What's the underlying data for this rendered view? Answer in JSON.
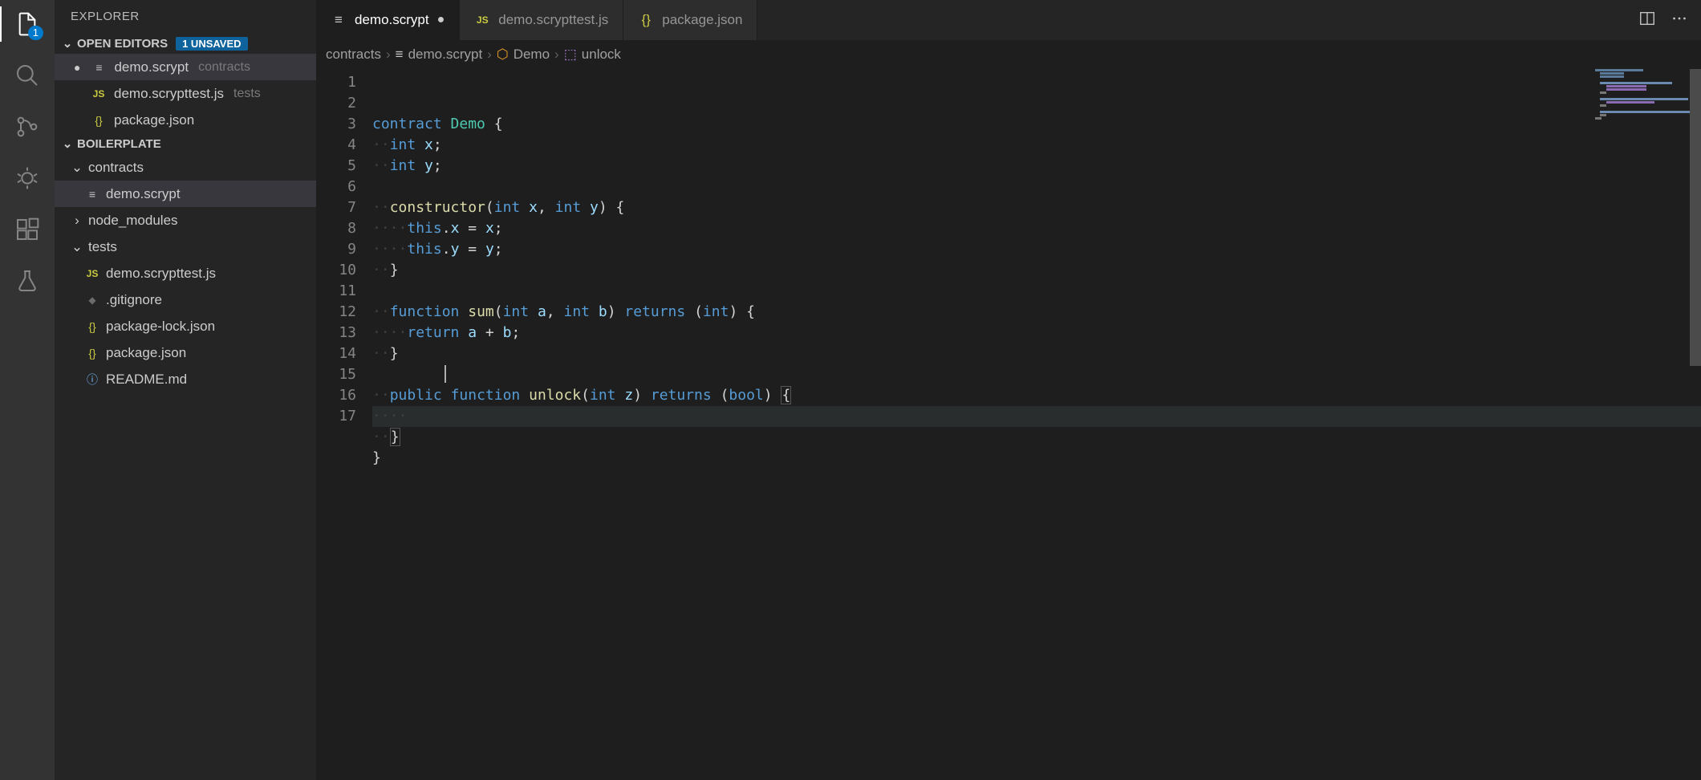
{
  "activity": {
    "explorer_badge": "1"
  },
  "sidebar": {
    "title": "EXPLORER",
    "open_editors_label": "OPEN EDITORS",
    "unsaved_label": "1 UNSAVED",
    "open_editors": [
      {
        "name": "demo.scrypt",
        "hint": "contracts",
        "dirty": true,
        "icon": "lines"
      },
      {
        "name": "demo.scrypttest.js",
        "hint": "tests",
        "dirty": false,
        "icon": "js"
      },
      {
        "name": "package.json",
        "hint": "",
        "dirty": false,
        "icon": "json"
      }
    ],
    "project_label": "BOILERPLATE",
    "tree": {
      "contracts": {
        "label": "contracts",
        "children": [
          {
            "name": "demo.scrypt",
            "icon": "lines"
          }
        ]
      },
      "node_modules": {
        "label": "node_modules"
      },
      "tests": {
        "label": "tests",
        "children": [
          {
            "name": "demo.scrypttest.js",
            "icon": "js"
          }
        ]
      },
      "gitignore": {
        "name": ".gitignore",
        "icon": "diamond"
      },
      "package_lock": {
        "name": "package-lock.json",
        "icon": "json"
      },
      "package": {
        "name": "package.json",
        "icon": "json"
      },
      "readme": {
        "name": "README.md",
        "icon": "info"
      }
    }
  },
  "tabs": [
    {
      "name": "demo.scrypt",
      "icon": "lines",
      "active": true,
      "dirty": true
    },
    {
      "name": "demo.scrypttest.js",
      "icon": "js",
      "active": false,
      "dirty": false
    },
    {
      "name": "package.json",
      "icon": "json",
      "active": false,
      "dirty": false
    }
  ],
  "breadcrumbs": {
    "folder": "contracts",
    "file": "demo.scrypt",
    "class": "Demo",
    "method": "unlock"
  },
  "editor": {
    "line_count": 17,
    "cursor_line": 15
  },
  "code_tokens": {
    "contract": "contract",
    "Demo": "Demo",
    "int": "int",
    "x": "x",
    "y": "y",
    "constructor": "constructor",
    "this": "this",
    "function": "function",
    "sum": "sum",
    "a": "a",
    "b": "b",
    "returns": "returns",
    "return": "return",
    "public": "public",
    "unlock": "unlock",
    "z": "z",
    "bool": "bool"
  }
}
